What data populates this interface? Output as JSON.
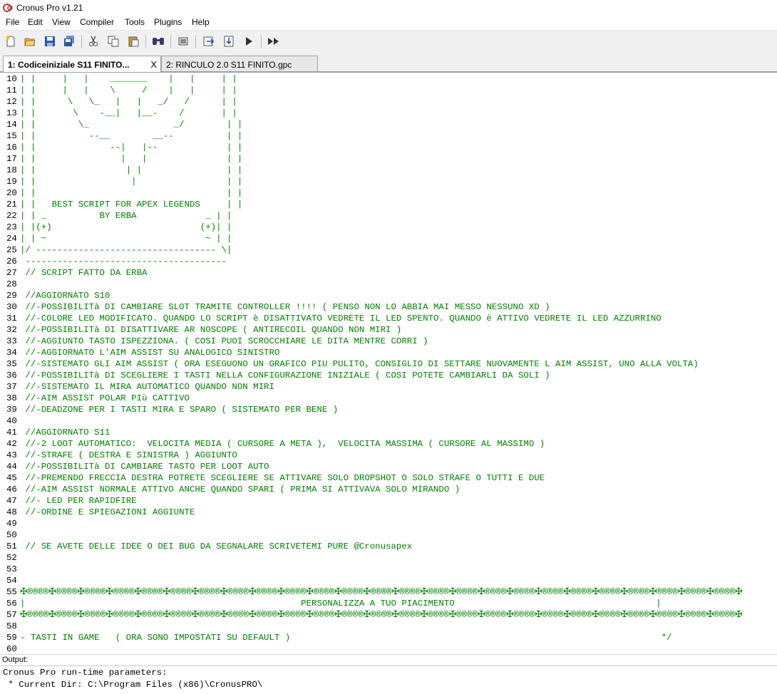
{
  "window": {
    "title": "Cronus Pro v1.21",
    "app_icon": "cronus-logo-icon"
  },
  "menu": [
    "File",
    "Edit",
    "View",
    "Compiler",
    "Tools",
    "Plugins",
    "Help"
  ],
  "toolbar": {
    "buttons": [
      "new-file-icon",
      "open-folder-icon",
      "save-icon",
      "save-all-icon",
      "cut-icon",
      "copy-icon",
      "paste-icon",
      "find-icon",
      "build-icon",
      "export-icon",
      "download-icon",
      "run-icon",
      "fast-forward-icon"
    ]
  },
  "tabs": [
    {
      "label": "1: Codiceiniziale S11 FINITO...",
      "close": "X",
      "active": true
    },
    {
      "label": "2: RINCULO 2.0 S11 FINITO.gpc",
      "active": false
    }
  ],
  "colors": {
    "code_comment": "#008000",
    "line_number": "#000000"
  },
  "editor": {
    "lines": [
      {
        "n": "10",
        "t": "| |     |   |    _______    |   |     | |"
      },
      {
        "n": "11",
        "t": "| |     |   |    \\     /    |   |     | |"
      },
      {
        "n": "12",
        "t": "| |      \\   \\_   |   |   _/   /      | |"
      },
      {
        "n": "13",
        "t": "| |       \\    -__|   |__-    /       | |"
      },
      {
        "n": "14",
        "t": "| |        \\_                _/        | |"
      },
      {
        "n": "15",
        "t": "| |          --__        __--          | |"
      },
      {
        "n": "16",
        "t": "| |              --|   |--             | |"
      },
      {
        "n": "17",
        "t": "| |                |   |               | |"
      },
      {
        "n": "18",
        "t": "| |                 | |                | |"
      },
      {
        "n": "19",
        "t": "| |                  |                 | |"
      },
      {
        "n": "20",
        "t": "| |                                    | |"
      },
      {
        "n": "21",
        "t": "| |   BEST SCRIPT FOR APEX LEGENDS     | |"
      },
      {
        "n": "22",
        "t": "| | _          BY ERBA             _ | |"
      },
      {
        "n": "23",
        "t": "| |(+)                            (+)| |"
      },
      {
        "n": "24",
        "t": "| | ~                              ~ | |"
      },
      {
        "n": "25",
        "t": "|/ ---------------------------------- \\|"
      },
      {
        "n": "26",
        "t": " --------------------------------------"
      },
      {
        "n": "27",
        "t": " // SCRIPT FATTO DA ERBA"
      },
      {
        "n": "28",
        "t": ""
      },
      {
        "n": "29",
        "t": " //AGGIORNATO S10"
      },
      {
        "n": "30",
        "t": " //-POSSIBILITà DI CAMBIARE SLOT TRAMITE CONTROLLER !!!! ( PENSO NON LO ABBIA MAI MESSO NESSUNO XD )"
      },
      {
        "n": "31",
        "t": " //-COLORE LED MODIFICATO. QUANDO LO SCRIPT è DISATTIVATO VEDRETE IL LED SPENTO. QUANDO è ATTIVO VEDRETE IL LED AZZURRINO"
      },
      {
        "n": "32",
        "t": " //-POSSIBILITà DI DISATTIVARE AR NOSCOPE ( ANTIRECOIL QUANDO NON MIRI )"
      },
      {
        "n": "33",
        "t": " //-AGGIUNTO TASTO ISPEZZIONA. ( COSI PUOI SCROCCHIARE LE DITA MENTRE CORRI )"
      },
      {
        "n": "34",
        "t": " //-AGGIORNATO L'AIM ASSIST SU ANALOGICO SINISTRO"
      },
      {
        "n": "35",
        "t": " //-SISTEMATO GLI AIM ASSIST ( ORA ESEGUONO UN GRAFICO PIU PULITO, CONSIGLIO DI SETTARE NUOVAMENTE L AIM ASSIST, UNO ALLA VOLTA)"
      },
      {
        "n": "36",
        "t": " //-POSSIBILITà DI SCEGLIERE I TASTI NELLA CONFIGURAZIONE INIZIALE ( COSI POTETE CAMBIARLI DA SOLI )"
      },
      {
        "n": "37",
        "t": " //-SISTEMATO IL MIRA AUTOMATICO QUANDO NON MIRI"
      },
      {
        "n": "38",
        "t": " //-AIM ASSIST POLAR PIù CATTIVO"
      },
      {
        "n": "39",
        "t": " //-DEADZONE PER I TASTI MIRA E SPARO ( SISTEMATO PER BENE )"
      },
      {
        "n": "40",
        "t": ""
      },
      {
        "n": "41",
        "t": " //AGGIORNATO S11"
      },
      {
        "n": "42",
        "t": " //-2 LOOT AUTOMATICO:  VELOCITA MEDIA ( CURSORE A META ),  VELOCITA MASSIMA ( CURSORE AL MASSIMO )"
      },
      {
        "n": "43",
        "t": " //-STRAFE ( DESTRA E SINISTRA ) AGGIUNTO"
      },
      {
        "n": "44",
        "t": " //-POSSIBILITà DI CAMBIARE TASTO PER LOOT AUTO"
      },
      {
        "n": "45",
        "t": " //-PREMENDO FRECCIA DESTRA POTRETE SCEGLIERE SE ATTIVARE SOLO DROPSHOT O SOLO STRAFE O TUTTI E DUE"
      },
      {
        "n": "46",
        "t": " //-AIM ASSIST NORMALE ATTIVO ANCHE QUANDO SPARI ( PRIMA SI ATTIVAVA SOLO MIRANDO )"
      },
      {
        "n": "47",
        "t": " //- LED PER RAPIDFIRE"
      },
      {
        "n": "48",
        "t": " //-ORDINE E SPIEGAZIONI AGGIUNTE"
      },
      {
        "n": "49",
        "t": ""
      },
      {
        "n": "50",
        "t": ""
      },
      {
        "n": "51",
        "t": " // SE AVETE DELLE IDEE O DEI BUG DA SEGNALARE SCRIVETEMI PURE @Cronusapex"
      },
      {
        "n": "52",
        "t": ""
      },
      {
        "n": "53",
        "t": ""
      },
      {
        "n": "54",
        "t": ""
      },
      {
        "n": "55",
        "t": "✠®®®®✠®®®®✠®®®®✠®®®®✠®®®®✠®®®®✠®®®®✠®®®®✠®®®®✠®®®®✠®®®®✠®®®®✠®®®®✠®®®®✠®®®®✠®®®®✠®®®®✠®®®®✠®®®®✠®®®®✠®®®®✠®®®®✠®®®®✠®®®®✠®®®®✠"
      },
      {
        "n": "56",
        "t": "|                                                    PERSONALIZZA A TUO PIACIMENTO                                      |"
      },
      {
        "n": "57",
        "t": "✠®®®®✠®®®®✠®®®®✠®®®®✠®®®®✠®®®®✠®®®®✠®®®®✠®®®®✠®®®®✠®®®®✠®®®®✠®®®®✠®®®®✠®®®®✠®®®®✠®®®®✠®®®®✠®®®®✠®®®®✠®®®®✠®®®®✠®®®®✠®®®®✠®®®®✠"
      },
      {
        "n": "58",
        "t": ""
      },
      {
        "n": "59",
        "t": "- TASTI IN GAME   ( ORA SONO IMPOSTATI SU DEFAULT )                                                                      */"
      },
      {
        "n": "60",
        "t": ""
      }
    ]
  },
  "output": {
    "label": "Output:",
    "lines": [
      "Cronus Pro run-time parameters:",
      " * Current Dir: C:\\Program Files (x86)\\CronusPRO\\"
    ]
  }
}
